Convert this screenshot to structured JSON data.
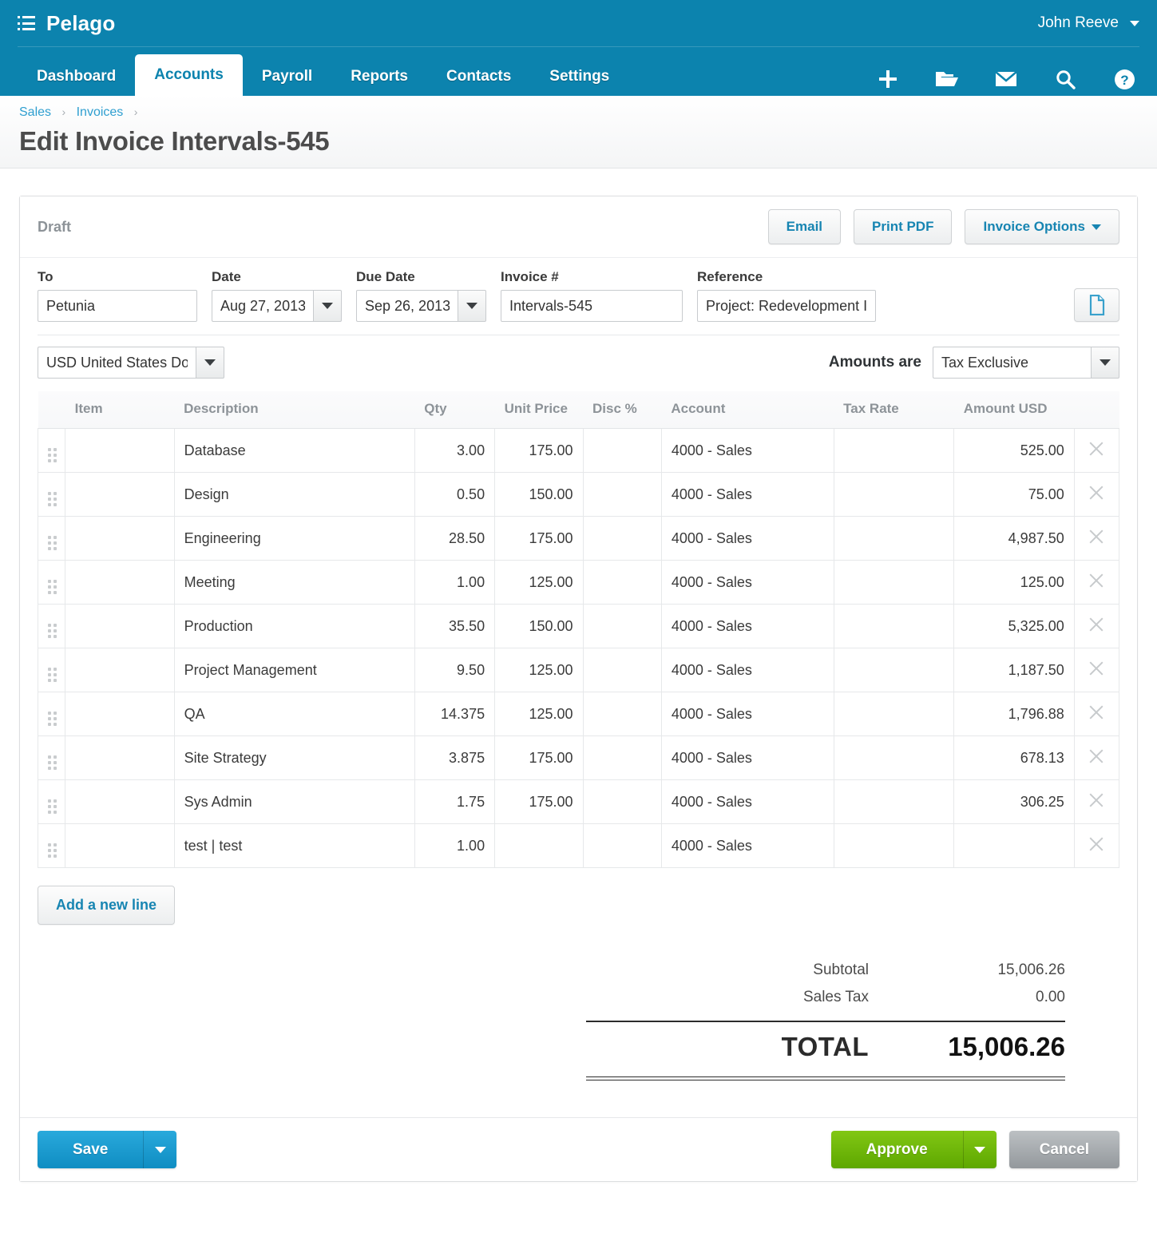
{
  "app": {
    "brand": "Pelago",
    "menu_icon": "list-menu-icon",
    "user": "John Reeve"
  },
  "nav": {
    "tabs": [
      {
        "label": "Dashboard",
        "active": false
      },
      {
        "label": "Accounts",
        "active": true
      },
      {
        "label": "Payroll",
        "active": false
      },
      {
        "label": "Reports",
        "active": false
      },
      {
        "label": "Contacts",
        "active": false
      },
      {
        "label": "Settings",
        "active": false
      }
    ],
    "icons": [
      "plus-icon",
      "folder-open-icon",
      "envelope-icon",
      "search-icon",
      "help-circle-icon"
    ]
  },
  "breadcrumb": {
    "items": [
      "Sales",
      "Invoices"
    ],
    "separator": "›",
    "trailing_separator": "›"
  },
  "page": {
    "title": "Edit Invoice Intervals-545"
  },
  "invoice": {
    "status": "Draft",
    "actions": {
      "email": "Email",
      "print_pdf": "Print PDF",
      "invoice_options": "Invoice Options"
    },
    "fields": {
      "to_label": "To",
      "to_value": "Petunia",
      "date_label": "Date",
      "date_value": "Aug 27, 2013",
      "due_date_label": "Due Date",
      "due_date_value": "Sep 26, 2013",
      "invoice_no_label": "Invoice #",
      "invoice_no_value": "Intervals-545",
      "reference_label": "Reference",
      "reference_value": "Project: Redevelopment Ite",
      "attach_icon": "document-attach-icon"
    },
    "currency_value": "USD United States Dollar",
    "amounts_are_label": "Amounts are",
    "tax_mode_value": "Tax Exclusive"
  },
  "table": {
    "headers": {
      "item": "Item",
      "description": "Description",
      "qty": "Qty",
      "unit_price": "Unit Price",
      "disc": "Disc %",
      "account": "Account",
      "tax_rate": "Tax Rate",
      "amount": "Amount USD"
    },
    "rows": [
      {
        "item": "",
        "description": "Database",
        "qty": "3.00",
        "unit_price": "175.00",
        "disc": "",
        "account": "4000 - Sales",
        "tax_rate": "",
        "amount": "525.00"
      },
      {
        "item": "",
        "description": "Design",
        "qty": "0.50",
        "unit_price": "150.00",
        "disc": "",
        "account": "4000 - Sales",
        "tax_rate": "",
        "amount": "75.00"
      },
      {
        "item": "",
        "description": "Engineering",
        "qty": "28.50",
        "unit_price": "175.00",
        "disc": "",
        "account": "4000 - Sales",
        "tax_rate": "",
        "amount": "4,987.50"
      },
      {
        "item": "",
        "description": "Meeting",
        "qty": "1.00",
        "unit_price": "125.00",
        "disc": "",
        "account": "4000 - Sales",
        "tax_rate": "",
        "amount": "125.00"
      },
      {
        "item": "",
        "description": "Production",
        "qty": "35.50",
        "unit_price": "150.00",
        "disc": "",
        "account": "4000 - Sales",
        "tax_rate": "",
        "amount": "5,325.00"
      },
      {
        "item": "",
        "description": "Project Management",
        "qty": "9.50",
        "unit_price": "125.00",
        "disc": "",
        "account": "4000 - Sales",
        "tax_rate": "",
        "amount": "1,187.50"
      },
      {
        "item": "",
        "description": "QA",
        "qty": "14.375",
        "unit_price": "125.00",
        "disc": "",
        "account": "4000 - Sales",
        "tax_rate": "",
        "amount": "1,796.88"
      },
      {
        "item": "",
        "description": "Site Strategy",
        "qty": "3.875",
        "unit_price": "175.00",
        "disc": "",
        "account": "4000 - Sales",
        "tax_rate": "",
        "amount": "678.13"
      },
      {
        "item": "",
        "description": "Sys Admin",
        "qty": "1.75",
        "unit_price": "175.00",
        "disc": "",
        "account": "4000 - Sales",
        "tax_rate": "",
        "amount": "306.25"
      },
      {
        "item": "",
        "description": "test | test",
        "qty": "1.00",
        "unit_price": "",
        "disc": "",
        "account": "4000 - Sales",
        "tax_rate": "",
        "amount": ""
      }
    ],
    "add_line_label": "Add a new line"
  },
  "totals": {
    "subtotal_label": "Subtotal",
    "subtotal_value": "15,006.26",
    "sales_tax_label": "Sales Tax",
    "sales_tax_value": "0.00",
    "total_label": "TOTAL",
    "total_value": "15,006.26"
  },
  "footer": {
    "save": "Save",
    "approve": "Approve",
    "cancel": "Cancel"
  },
  "colors": {
    "brand_blue": "#0c83ae",
    "link_blue": "#2f9fd0",
    "approve_green": "#6fb800",
    "save_blue": "#1790c4",
    "cancel_gray": "#a3a8ac"
  }
}
